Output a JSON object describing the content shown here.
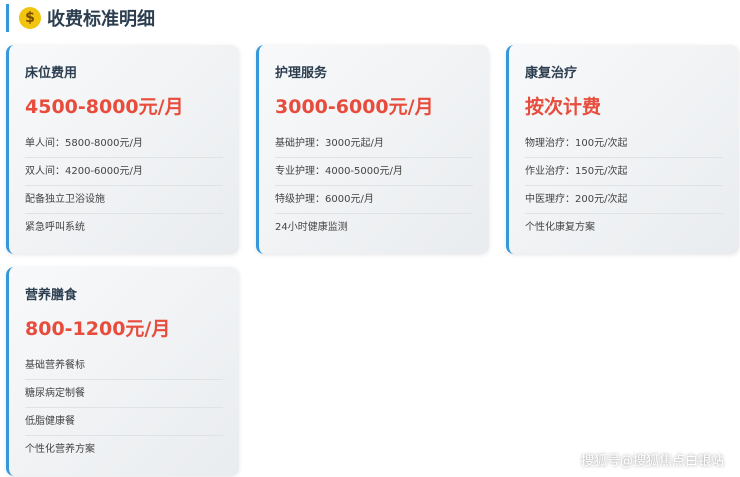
{
  "section": {
    "title": "收费标准明细",
    "icon": "money-bag-icon",
    "icon_glyph": "$"
  },
  "cards": [
    {
      "name": "床位费用",
      "price": "4500-8000元/月",
      "items": [
        "单人间：5800-8000元/月",
        "双人间：4200-6000元/月",
        "配备独立卫浴设施",
        "紧急呼叫系统"
      ]
    },
    {
      "name": "护理服务",
      "price": "3000-6000元/月",
      "items": [
        "基础护理：3000元起/月",
        "专业护理：4000-5000元/月",
        "特级护理：6000元/月",
        "24小时健康监测"
      ]
    },
    {
      "name": "康复治疗",
      "price": "按次计费",
      "items": [
        "物理治疗：100元/次起",
        "作业治疗：150元/次起",
        "中医理疗：200元/次起",
        "个性化康复方案"
      ]
    },
    {
      "name": "营养膳食",
      "price": "800-1200元/月",
      "items": [
        "基础营养餐标",
        "糖尿病定制餐",
        "低脂健康餐",
        "个性化营养方案"
      ]
    }
  ],
  "watermark": "搜狐号@搜狐焦点白银站",
  "colors": {
    "accent": "#3498db",
    "price": "#e74c3c",
    "title": "#2c3e50"
  }
}
